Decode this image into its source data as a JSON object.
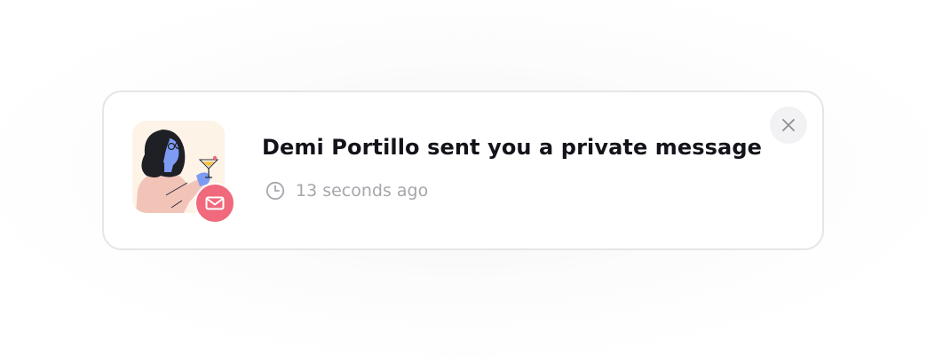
{
  "notification": {
    "title": "Demi Portillo sent you a private message",
    "time": "13 seconds ago",
    "avatar_icon": "woman-with-cocktail-illustration",
    "badge_icon": "envelope-icon",
    "time_icon": "clock-icon",
    "close_icon": "close-icon"
  },
  "colors": {
    "card_border": "#e6e6e9",
    "title_text": "#13131a",
    "muted_text": "#a6a6ad",
    "badge": "#f0697c",
    "avatar_bg": "#fdf3e7",
    "close_bg": "#f2f2f4"
  }
}
